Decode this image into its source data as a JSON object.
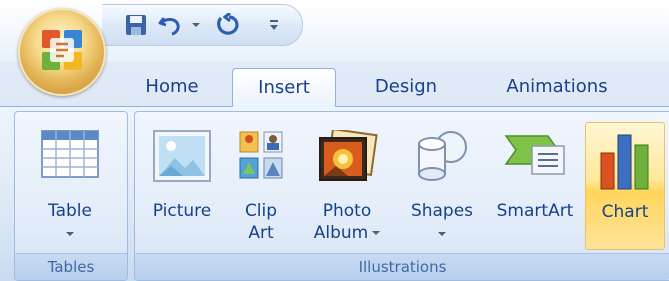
{
  "tabs": [
    {
      "label": "Home",
      "active": false
    },
    {
      "label": "Insert",
      "active": true
    },
    {
      "label": "Design",
      "active": false
    },
    {
      "label": "Animations",
      "active": false
    }
  ],
  "quick_access": {
    "items": [
      "save-icon",
      "undo-icon",
      "undo-dropdown-icon",
      "redo-icon",
      "customize-qat-icon"
    ]
  },
  "groups": {
    "tables": {
      "label": "Tables",
      "buttons": [
        {
          "label": "Table",
          "icon": "table-icon",
          "has_dropdown": true
        }
      ]
    },
    "illustrations": {
      "label": "Illustrations",
      "buttons": [
        {
          "label": "Picture",
          "icon": "picture-icon",
          "has_dropdown": false
        },
        {
          "label_line1": "Clip",
          "label_line2": "Art",
          "icon": "clip-art-icon",
          "has_dropdown": false
        },
        {
          "label_line1": "Photo",
          "label_line2": "Album",
          "icon": "photo-album-icon",
          "has_dropdown": true
        },
        {
          "label": "Shapes",
          "icon": "shapes-icon",
          "has_dropdown": true
        },
        {
          "label": "SmartArt",
          "icon": "smartart-icon",
          "has_dropdown": false
        },
        {
          "label": "Chart",
          "icon": "chart-icon",
          "has_dropdown": false,
          "highlighted": true
        }
      ]
    }
  },
  "colors": {
    "text": "#15428b",
    "highlight": "#ffd65c",
    "ribbon_border": "#8db2e3"
  }
}
